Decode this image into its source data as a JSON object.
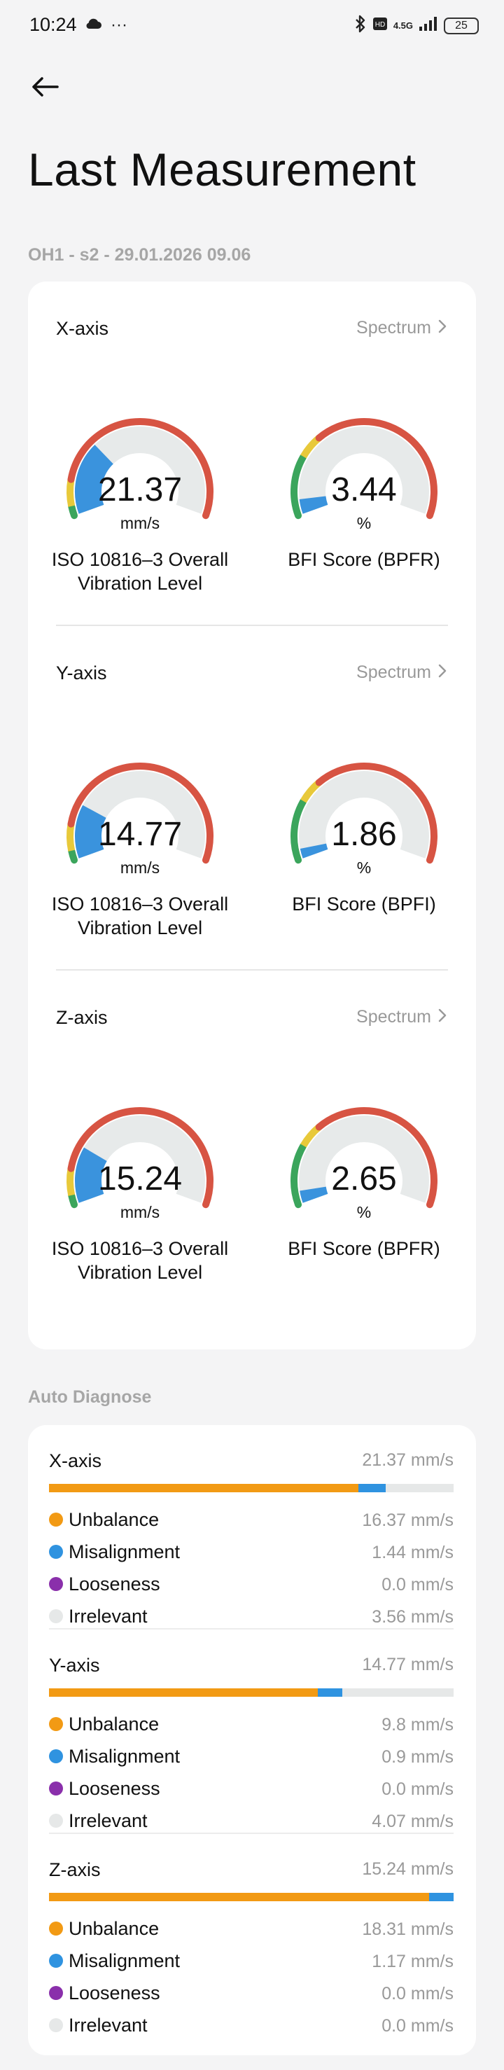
{
  "status_bar": {
    "time": "10:24",
    "overflow": "···",
    "network": "4.5G",
    "battery": "25"
  },
  "page": {
    "title": "Last Measurement",
    "meta": "OH1 - s2 - 29.01.2026 09.06"
  },
  "colors": {
    "gauge_red": "#d75443",
    "gauge_yellow": "#e8c93a",
    "gauge_green": "#3ba55c",
    "gauge_fill": "#3a93dd",
    "gauge_track": "#e7eaea",
    "unbalance": "#f29a14",
    "misalignment": "#2f93e0",
    "looseness": "#8a2fab",
    "irrelevant": "#e6e8e8"
  },
  "gauges": {
    "spectrum_label": "Spectrum",
    "axes": [
      {
        "axis": "X-axis",
        "iso": {
          "value": "21.37",
          "unit": "mm/s",
          "label_line1": "ISO 10816–3 Overall",
          "label_line2": "Vibration Level",
          "fill_fraction": 0.3
        },
        "bfi": {
          "value": "3.44",
          "unit": "%",
          "label": "BFI Score (BPFR)",
          "fill_fraction": 0.06
        }
      },
      {
        "axis": "Y-axis",
        "iso": {
          "value": "14.77",
          "unit": "mm/s",
          "label_line1": "ISO 10816–3 Overall",
          "label_line2": "Vibration Level",
          "fill_fraction": 0.22
        },
        "bfi": {
          "value": "1.86",
          "unit": "%",
          "label": "BFI Score (BPFI)",
          "fill_fraction": 0.04
        }
      },
      {
        "axis": "Z-axis",
        "iso": {
          "value": "15.24",
          "unit": "mm/s",
          "label_line1": "ISO 10816–3 Overall",
          "label_line2": "Vibration Level",
          "fill_fraction": 0.23
        },
        "bfi": {
          "value": "2.65",
          "unit": "%",
          "label": "BFI Score (BPFR)",
          "fill_fraction": 0.05
        }
      }
    ]
  },
  "auto_diagnose": {
    "heading": "Auto Diagnose",
    "sections": [
      {
        "axis": "X-axis",
        "total": "21.37 mm/s",
        "bar": [
          0.765,
          0.067,
          0.0,
          0.168
        ],
        "rows": [
          {
            "label": "Unbalance",
            "value": "16.37 mm/s"
          },
          {
            "label": "Misalignment",
            "value": "1.44 mm/s"
          },
          {
            "label": "Looseness",
            "value": "0.0 mm/s"
          },
          {
            "label": "Irrelevant",
            "value": "3.56 mm/s"
          }
        ]
      },
      {
        "axis": "Y-axis",
        "total": "14.77 mm/s",
        "bar": [
          0.664,
          0.061,
          0.0,
          0.275
        ],
        "rows": [
          {
            "label": "Unbalance",
            "value": "9.8 mm/s"
          },
          {
            "label": "Misalignment",
            "value": "0.9 mm/s"
          },
          {
            "label": "Looseness",
            "value": "0.0 mm/s"
          },
          {
            "label": "Irrelevant",
            "value": "4.07 mm/s"
          }
        ]
      },
      {
        "axis": "Z-axis",
        "total": "15.24 mm/s",
        "bar": [
          0.94,
          0.06,
          0.0,
          0.0
        ],
        "rows": [
          {
            "label": "Unbalance",
            "value": "18.31 mm/s"
          },
          {
            "label": "Misalignment",
            "value": "1.17 mm/s"
          },
          {
            "label": "Looseness",
            "value": "0.0 mm/s"
          },
          {
            "label": "Irrelevant",
            "value": "0.0 mm/s"
          }
        ]
      }
    ]
  }
}
